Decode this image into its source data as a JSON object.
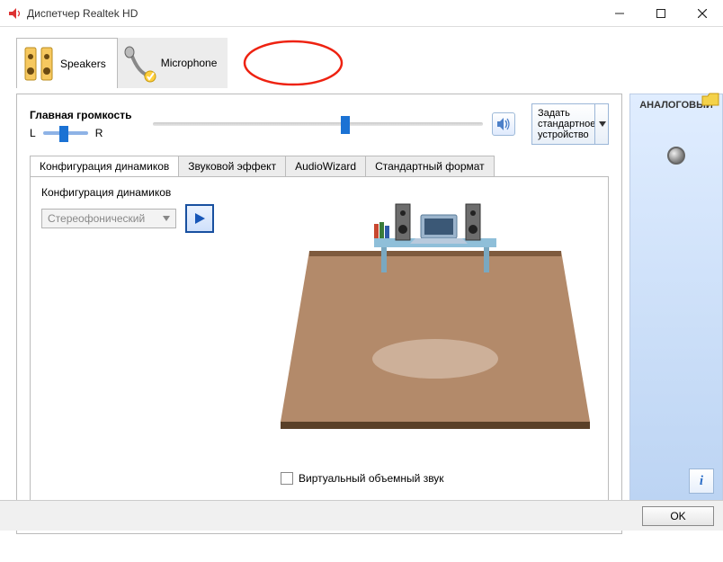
{
  "window": {
    "title": "Диспетчер Realtek HD"
  },
  "device_tabs": {
    "speakers": "Speakers",
    "microphone": "Microphone"
  },
  "volume": {
    "label": "Главная громкость",
    "left": "L",
    "right": "R"
  },
  "default_device": {
    "line1": "Задать",
    "line2": "стандартное",
    "line3": "устройство"
  },
  "subtabs": {
    "config": "Конфигурация динамиков",
    "soundfx": "Звуковой эффект",
    "audiowizard": "AudioWizard",
    "defaultfmt": "Стандартный формат"
  },
  "speaker_config": {
    "label": "Конфигурация динамиков",
    "selected": "Стереофонический",
    "virtual_surround": "Виртуальный объемный звук"
  },
  "side": {
    "label": "АНАЛОГОВЫЙ"
  },
  "footer": {
    "ok": "OK",
    "info": "i"
  }
}
